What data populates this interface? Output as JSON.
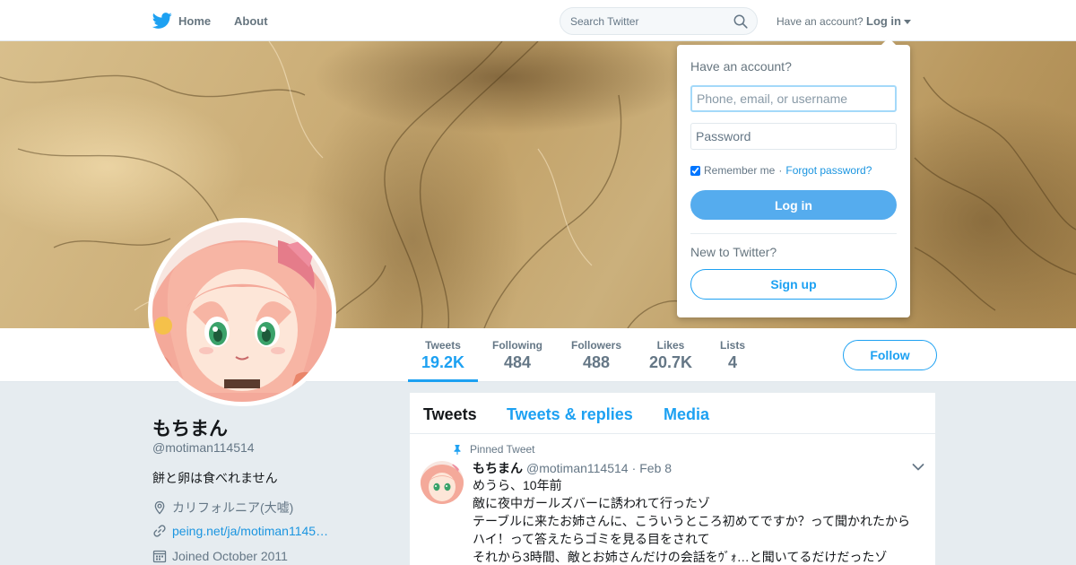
{
  "nav": {
    "home_label": "Home",
    "about_label": "About",
    "search_placeholder": "Search Twitter",
    "have_account": "Have an account?",
    "login_label": "Log in",
    "accent_color": "#1da1f2"
  },
  "profile": {
    "name": "もちまん",
    "handle": "@motiman114514",
    "bio": "餅と卵は食べれません",
    "location": "カリフォルニア(大嘘)",
    "website": "peing.net/ja/motiman1145…",
    "joined": "Joined October 2011"
  },
  "stats": [
    {
      "label": "Tweets",
      "value": "19.2K"
    },
    {
      "label": "Following",
      "value": "484"
    },
    {
      "label": "Followers",
      "value": "488"
    },
    {
      "label": "Likes",
      "value": "20.7K"
    },
    {
      "label": "Lists",
      "value": "4"
    }
  ],
  "follow_label": "Follow",
  "timeline": {
    "tabs": [
      "Tweets",
      "Tweets & replies",
      "Media"
    ],
    "pinned_label": "Pinned Tweet",
    "tweet": {
      "name": "もちまん",
      "handle": "@motiman114514",
      "dot": "·",
      "date": "Feb 8",
      "lines": [
        "めうら、10年前",
        "敵に夜中ガールズバーに誘われて行ったゾ",
        "テーブルに来たお姉さんに、こういうところ初めてですか？って聞かれたから",
        "ハイ！って答えたらゴミを見る目をされて",
        "それから3時間、敵とお姉さんだけの会話をｳﾞｫ…と聞いてるだけだったゾ"
      ]
    }
  },
  "login_dropdown": {
    "title": "Have an account?",
    "username_placeholder": "Phone, email, or username",
    "password_placeholder": "Password",
    "remember_label": "Remember me",
    "separator": "·",
    "forgot_label": "Forgot password?",
    "login_button": "Log in",
    "new_label": "New to Twitter?",
    "signup_button": "Sign up"
  }
}
